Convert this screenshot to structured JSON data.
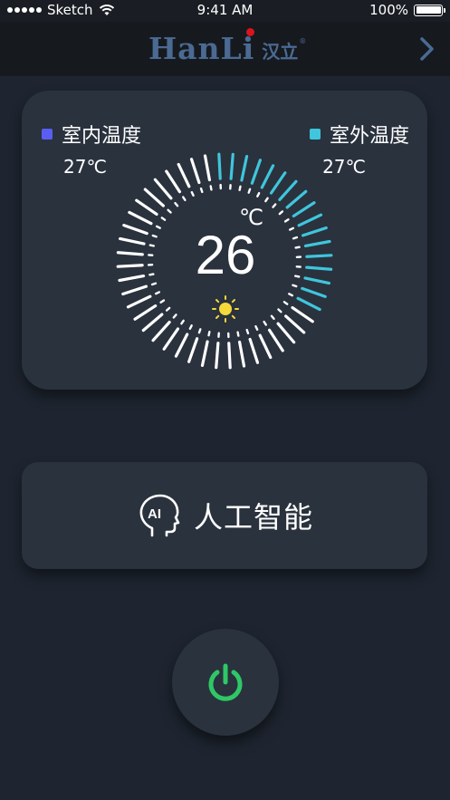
{
  "status_bar": {
    "carrier": "Sketch",
    "time": "9:41 AM",
    "battery": "100%"
  },
  "nav": {
    "logo_latin": "HanLi",
    "logo_chinese": "汉立",
    "logo_mark": "®",
    "next_icon": "chevron-right-icon"
  },
  "climate": {
    "indoor_label": "室内温度",
    "indoor_value": "27℃",
    "outdoor_label": "室外温度",
    "outdoor_value": "27℃",
    "setpoint": "26",
    "unit": "℃",
    "mode_icon": "sun-icon",
    "dial_active_fraction": 0.36
  },
  "ai": {
    "label": "人工智能",
    "icon": "ai-head-icon"
  },
  "power": {
    "icon": "power-icon"
  },
  "colors": {
    "background": "#1e2530",
    "card": "#2a323e",
    "indoor_square": "#5a5ef0",
    "outdoor_square": "#3fc6dc",
    "dial_active": "#3fc6dc",
    "dial_inactive": "#ffffff",
    "sun": "#f5d83a",
    "power": "#2ec866",
    "logo": "#4b6a93",
    "logo_dot": "#d8141c"
  }
}
